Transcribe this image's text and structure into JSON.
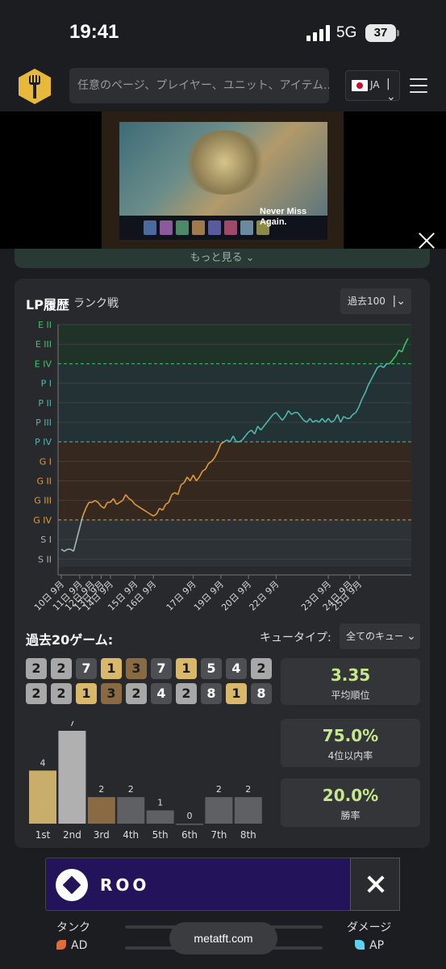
{
  "status_bar": {
    "time": "19:41",
    "network": "5G",
    "battery": "37"
  },
  "nav": {
    "search_placeholder": "任意のページ、プレイヤー、ユニット、アイテム...",
    "language": "JA"
  },
  "video_ad": {
    "text": "Never Miss\nAgain."
  },
  "prev_section": {
    "see_more": "もっと見る ⌄"
  },
  "lp_history": {
    "title": "LP履歴",
    "subtitle": "ランク戦",
    "range_select": "過去100"
  },
  "chart_data": {
    "type": "line",
    "title": "LP履歴",
    "y_tick_labels": [
      "E II",
      "E III",
      "E IV",
      "P I",
      "P II",
      "P III",
      "P IV",
      "G I",
      "G II",
      "G III",
      "G IV",
      "S I",
      "S II"
    ],
    "x_tick_labels": [
      "10日 9月",
      "11日 9月",
      "12日 9月",
      "13日 9月",
      "14日 9月",
      "15日 9月",
      "16日 9月",
      "17日 9月",
      "19日 9月",
      "20日 9月",
      "22日 9月",
      "23日 9月",
      "24日 9月",
      "25日 9月"
    ],
    "tier_colors": {
      "silver": "#a9b4b8",
      "gold": "#e09a3e",
      "platinum": "#4fb8b0",
      "emerald": "#3fc26b"
    },
    "series": [
      {
        "values": [
          0.5,
          0.4,
          0.5,
          0.5,
          0.4,
          1.0,
          1.6,
          2.2,
          2.6,
          2.9,
          2.9,
          3.0,
          2.9,
          2.7,
          2.6,
          2.9,
          2.9,
          3.1,
          2.8,
          2.9,
          3.0,
          3.3,
          3.1,
          3.0,
          2.8,
          2.7,
          2.6,
          2.5,
          2.4,
          2.3,
          2.2,
          2.3,
          2.6,
          2.5,
          2.8,
          2.9,
          3.3,
          3.4,
          3.3,
          3.8,
          3.9,
          4.2,
          4.0,
          4.3,
          4.0,
          4.2,
          4.5,
          4.6,
          4.9,
          5.0,
          5.2,
          5.5,
          5.9,
          6.0,
          6.1,
          6.0,
          6.3,
          6.0,
          6.0,
          6.1,
          6.3,
          6.5,
          6.6,
          6.4,
          6.8,
          6.6,
          6.8,
          7.0,
          7.2,
          7.4,
          7.5,
          7.3,
          7.1,
          7.3,
          7.6,
          7.4,
          7.5,
          7.5,
          7.3,
          7.1,
          7.0,
          7.2,
          7.0,
          7.1,
          7.0,
          7.2,
          7.0,
          7.2,
          7.0,
          7.1,
          7.4,
          7.0,
          7.3,
          7.2,
          7.2,
          7.4,
          7.5,
          7.8,
          8.2,
          8.5,
          8.9,
          9.2,
          9.5,
          9.8,
          9.9,
          9.8,
          10.0,
          10.0,
          10.2,
          10.4,
          10.7,
          10.6,
          11.0,
          11.3
        ]
      }
    ]
  },
  "last20": {
    "title": "過去20ゲーム:",
    "queue_label": "キュータイプ:",
    "queue_select": "全てのキュー",
    "placements": [
      2,
      2,
      7,
      1,
      3,
      7,
      1,
      5,
      4,
      2,
      2,
      2,
      1,
      3,
      2,
      4,
      2,
      8,
      1,
      8
    ],
    "stats": [
      {
        "value": "3.35",
        "label": "平均順位"
      },
      {
        "value": "75.0%",
        "label": "4位以内率"
      },
      {
        "value": "20.0%",
        "label": "勝率"
      }
    ],
    "distribution": {
      "labels": [
        "1st",
        "2nd",
        "3rd",
        "4th",
        "5th",
        "6th",
        "7th",
        "8th"
      ],
      "counts": [
        4,
        7,
        2,
        2,
        1,
        0,
        2,
        2
      ],
      "colors": [
        "#c9ad6a",
        "#b0b0b0",
        "#8a6a43",
        "#5e6063",
        "#5e6063",
        "#5e6063",
        "#5e6063",
        "#5e6063"
      ]
    }
  },
  "ad_banner": {
    "brand": "ROO"
  },
  "bottom": {
    "tank_label": "タンク",
    "ad_label": "AD",
    "damage_label": "ダメージ",
    "ap_label": "AP",
    "url": "metatft.com"
  }
}
